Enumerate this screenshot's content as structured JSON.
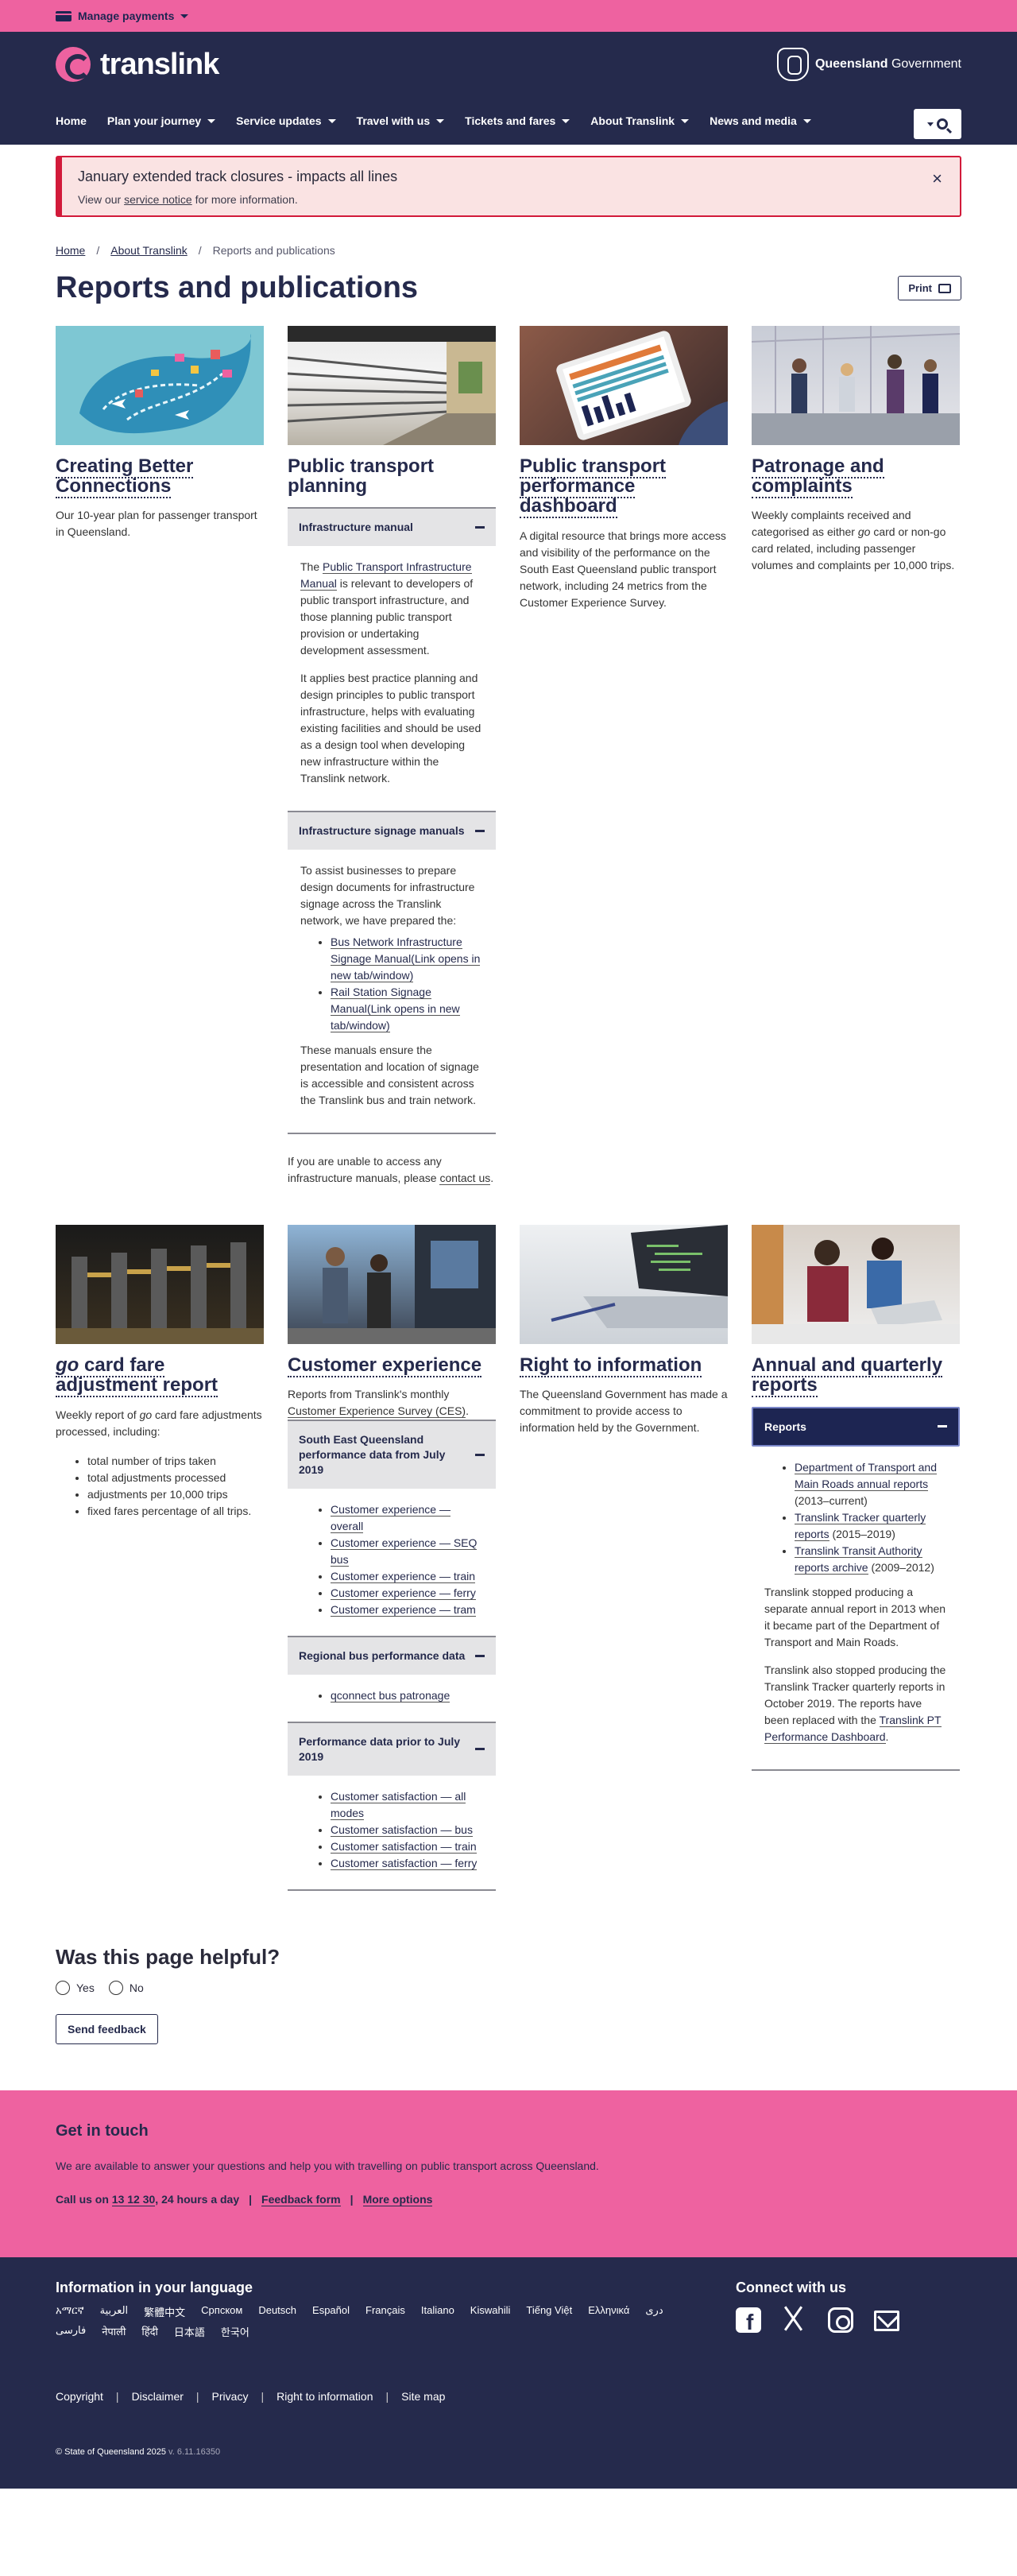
{
  "topbar": {
    "manage_payments": "Manage payments"
  },
  "header": {
    "brand": "translink",
    "gov_bold": "Queensland",
    "gov_regular": " Government",
    "nav": [
      "Home",
      "Plan your journey",
      "Service updates",
      "Travel with us",
      "Tickets and fares",
      "About Translink",
      "News and media"
    ]
  },
  "alert": {
    "title": "January extended track closures - impacts all lines",
    "text_pre": "View our ",
    "link": "service notice",
    "text_post": " for more information.",
    "close": "×"
  },
  "breadcrumb": [
    "Home",
    "About Translink",
    "Reports and publications"
  ],
  "page_title": "Reports and publications",
  "print_label": "Print",
  "cards": {
    "c1": {
      "title": "Creating Better Connections",
      "desc": "Our 10-year plan for passenger transport in Queensland."
    },
    "c2": {
      "title": "Public transport planning",
      "acc1_title": "Infrastructure manual",
      "acc1_p1_pre": "The ",
      "acc1_p1_link": "Public Transport Infrastructure Manual",
      "acc1_p1_post": " is relevant to developers of public transport infrastructure, and those planning public transport provision or undertaking development assessment.",
      "acc1_p2": "It applies best practice planning and design principles to public transport infrastructure, helps with evaluating existing facilities and should be used as a design tool when developing new infrastructure within the Translink network.",
      "acc2_title": "Infrastructure signage manuals",
      "acc2_p1": "To assist businesses to prepare design documents for infrastructure signage across the Translink network, we have prepared the:",
      "acc2_links": [
        "Bus Network Infrastructure Signage Manual(Link opens in new tab/window)",
        "Rail Station Signage Manual(Link opens in new tab/window)"
      ],
      "acc2_p2": "These manuals ensure the presentation and location of signage is accessible and consistent across the Translink bus and train network.",
      "tail_pre": "If you are unable to access any infrastructure manuals, please ",
      "tail_link": "contact us",
      "tail_post": "."
    },
    "c3": {
      "title": "Public transport performance dashboard",
      "desc": "A digital resource that brings more access and visibility of the performance on the South East Queensland public transport network, including 24 metrics from the Customer Experience Survey."
    },
    "c4": {
      "title": "Patronage and complaints",
      "desc_pre": "Weekly complaints received and categorised as either ",
      "desc_em": "go",
      "desc_post": " card or non-go card related, including passenger volumes and complaints per 10,000 trips."
    },
    "c5": {
      "title_em": "go",
      "title_rest": " card fare adjustment report",
      "desc_pre": "Weekly report of ",
      "desc_em": "go",
      "desc_post": " card fare adjustments processed, including:",
      "bullets": [
        "total number of trips taken",
        "total adjustments processed",
        "adjustments per 10,000 trips",
        "fixed fares percentage of all trips."
      ]
    },
    "c6": {
      "title": "Customer experience",
      "desc_pre": "Reports from Translink's monthly ",
      "desc_link": "Customer Experience Survey (CES)",
      "desc_post": ".",
      "acc1_title": "South East Queensland performance data from July 2019",
      "acc1_links": [
        "Customer experience — overall",
        "Customer experience — SEQ bus",
        "Customer experience — train",
        "Customer experience — ferry",
        "Customer experience — tram"
      ],
      "acc2_title": "Regional bus performance data",
      "acc2_links": [
        "qconnect bus patronage"
      ],
      "acc3_title": "Performance data prior to July 2019",
      "acc3_links": [
        "Customer satisfaction — all modes",
        "Customer satisfaction — bus",
        "Customer satisfaction — train",
        "Customer satisfaction — ferry"
      ]
    },
    "c7": {
      "title": "Right to information",
      "desc": "The Queensland Government has made a commitment to provide access to information held by the Government."
    },
    "c8": {
      "title": "Annual and quarterly reports",
      "acc_title": "Reports",
      "items": [
        {
          "link": "Department of Transport and Main Roads annual reports",
          "suffix": " (2013–current)"
        },
        {
          "link": "Translink Tracker quarterly reports",
          "suffix": " (2015–2019)"
        },
        {
          "link": "Translink Transit Authority reports archive",
          "suffix": " (2009–2012)"
        }
      ],
      "p1": "Translink stopped producing a separate annual report in 2013 when it became part of the Department of Transport and Main Roads.",
      "p2_pre": "Translink also stopped producing the Translink Tracker quarterly reports in October 2019. The reports have been replaced with the ",
      "p2_link": "Translink PT Performance Dashboard",
      "p2_post": "."
    }
  },
  "helpful": {
    "title": "Was this page helpful?",
    "yes": "Yes",
    "no": "No",
    "send": "Send feedback"
  },
  "touch": {
    "title": "Get in touch",
    "text": "We are available to answer your questions and help you with travelling on public transport across Queensland.",
    "call_pre": "Call us on ",
    "call_num": "13 12 30",
    "call_post": ", 24 hours a day",
    "feedback": "Feedback form",
    "more": "More options",
    "sep": "|"
  },
  "footer": {
    "lang_title": "Information in your language",
    "langs": [
      "አማርኛ",
      "العربية",
      "繁體中文",
      "Српском",
      "Deutsch",
      "Español",
      "Français",
      "Italiano",
      "Kiswahili",
      "Tiếng Việt",
      "Ελληνικά",
      "دری",
      "فارسی",
      "नेपाली",
      "हिंदी",
      "日本語",
      "한국어"
    ],
    "connect": "Connect with us",
    "links": [
      "Copyright",
      "Disclaimer",
      "Privacy",
      "Right to information",
      "Site map"
    ],
    "copyright": "© State of Queensland 2025",
    "version": " v. 6.11.16350"
  },
  "colors": {
    "pink": "#ee62a0",
    "navy": "#252a4c",
    "alert_red": "#d21a3a"
  }
}
